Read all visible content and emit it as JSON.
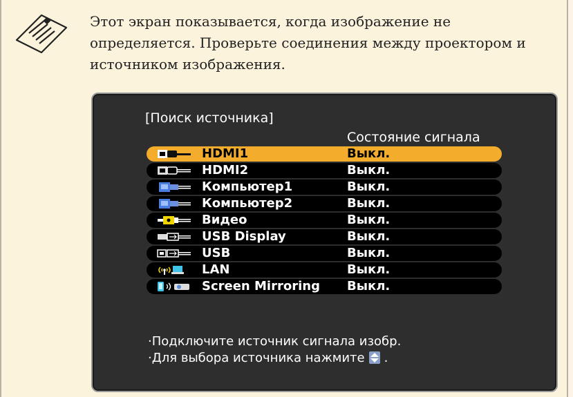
{
  "note": {
    "text_lines": [
      "Этот экран показывается, когда изображение не",
      "определяется. Проверьте соединения между проектором и",
      "источником изображения."
    ]
  },
  "screen": {
    "title": "[Поиск источника]",
    "status_header": "Состояние сигнала",
    "sources": [
      {
        "name": "HDMI1",
        "status": "Выкл.",
        "icon": "hdmi-icon"
      },
      {
        "name": "HDMI2",
        "status": "Выкл.",
        "icon": "hdmi-icon"
      },
      {
        "name": "Компьютер1",
        "status": "Выкл.",
        "icon": "computer-vga-icon"
      },
      {
        "name": "Компьютер2",
        "status": "Выкл.",
        "icon": "computer-vga-icon"
      },
      {
        "name": "Видео",
        "status": "Выкл.",
        "icon": "video-rca-icon"
      },
      {
        "name": "USB Display",
        "status": "Выкл.",
        "icon": "usb-display-icon"
      },
      {
        "name": "USB",
        "status": "Выкл.",
        "icon": "usb-icon"
      },
      {
        "name": "LAN",
        "status": "Выкл.",
        "icon": "lan-wireless-icon"
      },
      {
        "name": "Screen Mirroring",
        "status": "Выкл.",
        "icon": "screen-mirroring-icon"
      }
    ],
    "selected_index": 0,
    "hint_connect": "·Подключите источник сигнала изобр.",
    "hint_select_prefix": "·Для выбора источника нажмите",
    "hint_select_suffix": "."
  },
  "colors": {
    "note_bg": "#fcf3dc",
    "screen_bg": "#2e2e2e",
    "row_bg": "#000000",
    "selected_bg": "#f4ac2d",
    "text": "#ffffff"
  }
}
